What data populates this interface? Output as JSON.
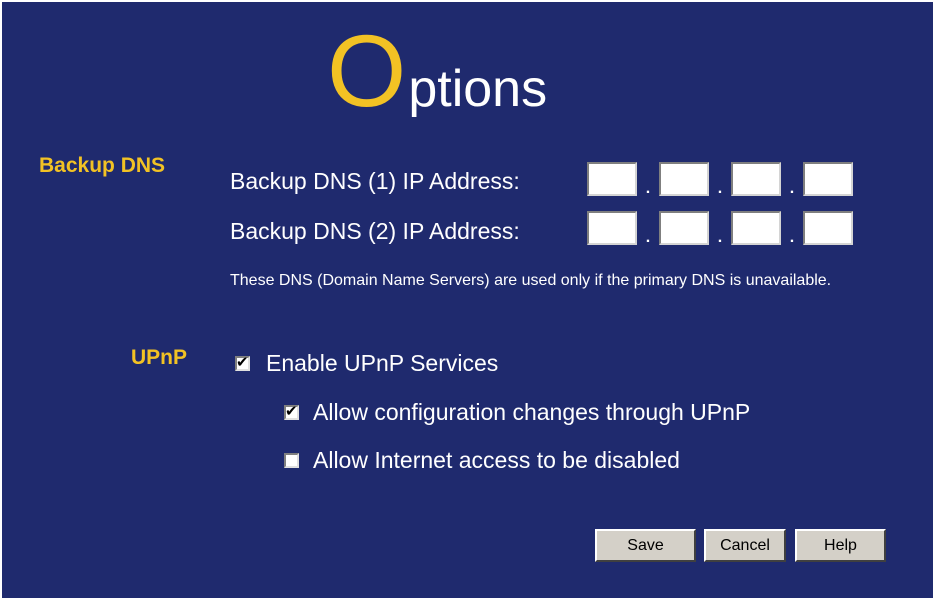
{
  "page": {
    "title_first_letter": "O",
    "title_rest": "ptions"
  },
  "backup_dns": {
    "section_label": "Backup DNS",
    "dns1_label": "Backup DNS (1) IP Address:",
    "dns2_label": "Backup DNS (2) IP Address:",
    "dns1_octets": [
      "",
      "",
      "",
      ""
    ],
    "dns2_octets": [
      "",
      "",
      "",
      ""
    ],
    "separator": ".",
    "note": "These DNS (Domain Name Servers) are used only if the primary DNS is unavailable."
  },
  "upnp": {
    "section_label": "UPnP",
    "enable_label": "Enable UPnP Services",
    "enable_checked": true,
    "allow_config_label": "Allow configuration changes through UPnP",
    "allow_config_checked": true,
    "allow_disable_label": "Allow Internet access to be disabled",
    "allow_disable_checked": false
  },
  "buttons": {
    "save": "Save",
    "cancel": "Cancel",
    "help": "Help"
  },
  "colors": {
    "background": "#1f2a6e",
    "accent": "#f2c224",
    "text": "#ffffff",
    "button_face": "#d4d0c8"
  }
}
